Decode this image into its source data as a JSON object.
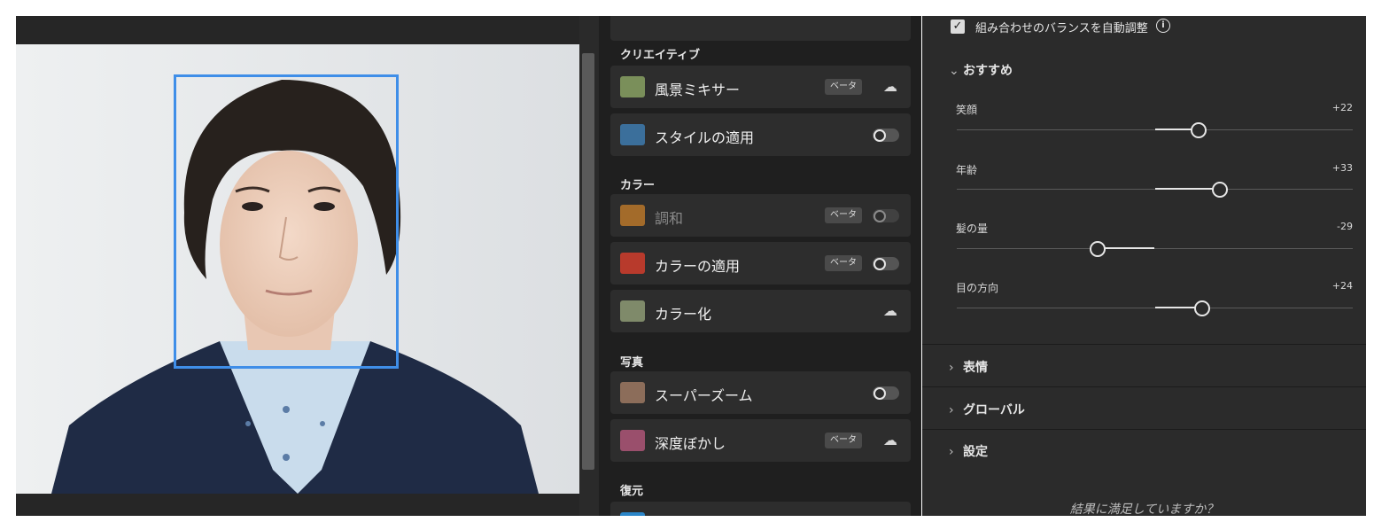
{
  "viewer": {
    "face_box_label": ""
  },
  "filters": {
    "sections": [
      {
        "title": "クリエイティブ"
      },
      {
        "title": "カラー"
      },
      {
        "title": "写真"
      },
      {
        "title": "復元"
      }
    ],
    "items": [
      {
        "label": "風景ミキサー",
        "badge": "ベータ",
        "action": "cloud-download-icon",
        "thumb_color": "#7a8f5a"
      },
      {
        "label": "スタイルの適用",
        "action": "toggle-off",
        "thumb_color": "#3b6f9b"
      },
      {
        "label": "調和",
        "badge": "ベータ",
        "action": "toggle-off",
        "disabled": "true",
        "thumb_color": "#a36b2a"
      },
      {
        "label": "カラーの適用",
        "badge": "ベータ",
        "action": "toggle-off",
        "thumb_color": "#b83a2c"
      },
      {
        "label": "カラー化",
        "action": "cloud-download-icon",
        "thumb_color": "#7f8a6a"
      },
      {
        "label": "スーパーズーム",
        "action": "toggle-off",
        "thumb_color": "#8c6d5a"
      },
      {
        "label": "深度ぼかし",
        "badge": "ベータ",
        "action": "cloud-download-icon",
        "thumb_color": "#9a4f6c"
      }
    ]
  },
  "panel": {
    "auto_balance_label": "組み合わせのバランスを自動調整",
    "auto_balance_checked": true,
    "recommended_title": "おすすめ",
    "sliders": [
      {
        "label": "笑顔",
        "value": "+22",
        "numeric": 22
      },
      {
        "label": "年齢",
        "value": "+33",
        "numeric": 33
      },
      {
        "label": "髪の量",
        "value": "-29",
        "numeric": -29
      },
      {
        "label": "目の方向",
        "value": "+24",
        "numeric": 24
      }
    ],
    "collapsed_sections": [
      {
        "title": "表情"
      },
      {
        "title": "グローバル"
      },
      {
        "title": "設定"
      }
    ],
    "feedback_question": "結果に満足していますか？"
  }
}
